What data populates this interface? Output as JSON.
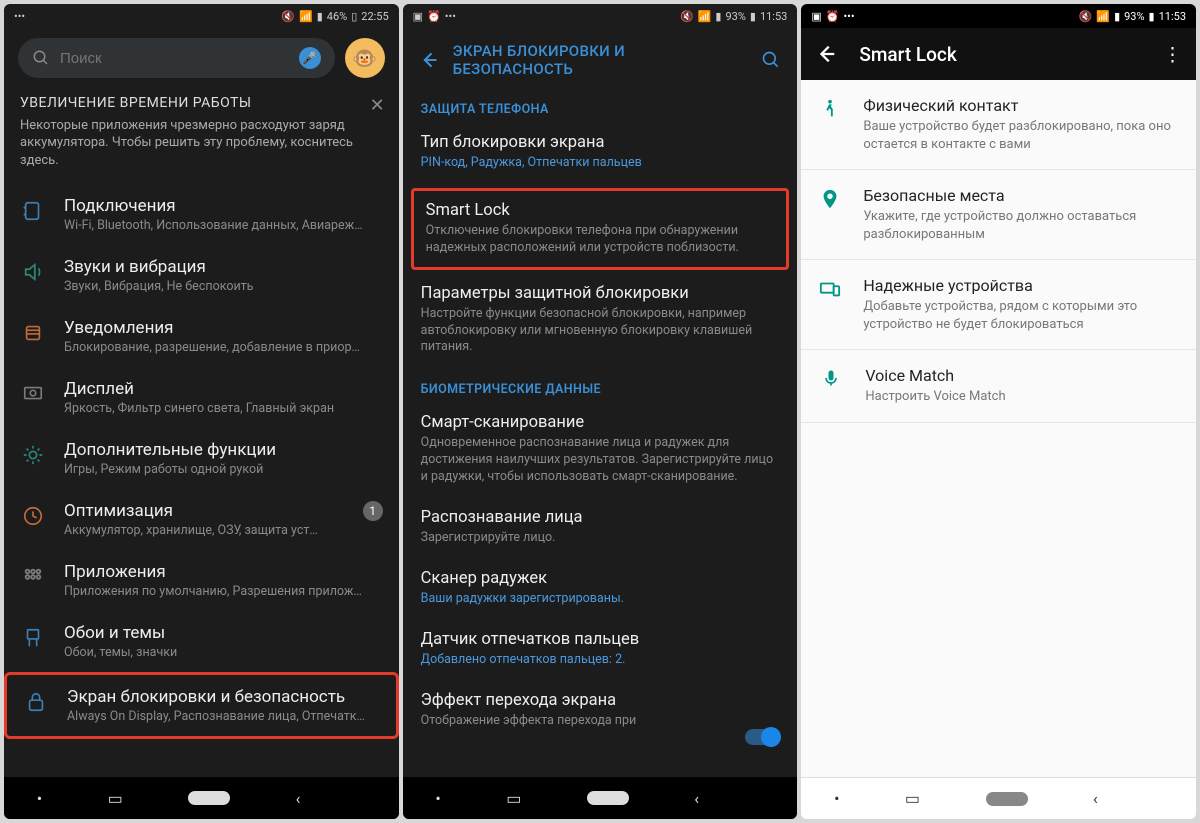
{
  "screen1": {
    "status": {
      "battery": "46%",
      "time": "22:55"
    },
    "search": {
      "placeholder": "Поиск"
    },
    "tip": {
      "title": "УВЕЛИЧЕНИЕ ВРЕМЕНИ РАБОТЫ",
      "body": "Некоторые приложения чрезмерно расходуют заряд аккумулятора. Чтобы решить эту проблему, коснитесь здесь."
    },
    "items": [
      {
        "title": "Подключения",
        "sub": "Wi-Fi, Bluetooth, Использование данных, Авиареж…",
        "icon": "connections"
      },
      {
        "title": "Звуки и вибрация",
        "sub": "Звуки, Вибрация, Не беспокоить",
        "icon": "sound"
      },
      {
        "title": "Уведомления",
        "sub": "Блокирование, разрешение, добавление в приор…",
        "icon": "notifications"
      },
      {
        "title": "Дисплей",
        "sub": "Яркость, Фильтр синего света, Главный экран",
        "icon": "display"
      },
      {
        "title": "Дополнительные функции",
        "sub": "Игры, Режим работы одной рукой",
        "icon": "advanced"
      },
      {
        "title": "Оптимизация",
        "sub": "Аккумулятор, хранилище, ОЗУ, защита уст…",
        "icon": "optimization",
        "badge": "1"
      },
      {
        "title": "Приложения",
        "sub": "Приложения по умолчанию, Разрешения прилож…",
        "icon": "apps"
      },
      {
        "title": "Обои и темы",
        "sub": "Обои, темы, значки",
        "icon": "themes"
      },
      {
        "title": "Экран блокировки и безопасность",
        "sub": "Always On Display, Распознавание лица, Отпечатк…",
        "icon": "lock",
        "highlight": true
      }
    ]
  },
  "screen2": {
    "status": {
      "battery": "93%",
      "time": "11:53"
    },
    "header": "ЭКРАН БЛОКИРОВКИ И БЕЗОПАСНОСТЬ",
    "section1": "ЗАЩИТА ТЕЛЕФОНА",
    "section2": "БИОМЕТРИЧЕСКИЕ ДАННЫЕ",
    "items1": [
      {
        "t": "Тип блокировки экрана",
        "s": "PIN-код, Радужка, Отпечатки пальцев",
        "blue": true
      },
      {
        "t": "Smart Lock",
        "s": "Отключение блокировки телефона при обнаружении надежных расположений или устройств поблизости.",
        "highlight": true
      },
      {
        "t": "Параметры защитной блокировки",
        "s": "Настройте функции безопасной блокировки, например автоблокировку или мгновенную блокировку клавишей питания."
      }
    ],
    "items2": [
      {
        "t": "Смарт-сканирование",
        "s": "Одновременное распознавание лица и радужек для достижения наилучших результатов. Зарегистрируйте лицо и радужки, чтобы использовать смарт-сканирование."
      },
      {
        "t": "Распознавание лица",
        "s": "Зарегистрируйте лицо."
      },
      {
        "t": "Сканер радужек",
        "s": "Ваши радужки зарегистрированы.",
        "blue": true
      },
      {
        "t": "Датчик отпечатков пальцев",
        "s": "Добавлено отпечатков пальцев: 2.",
        "blue": true
      },
      {
        "t": "Эффект перехода экрана",
        "s": "Отображение эффекта перехода при",
        "toggle": true
      }
    ]
  },
  "screen3": {
    "status": {
      "battery": "93%",
      "time": "11:53"
    },
    "title": "Smart Lock",
    "rows": [
      {
        "t": "Физический контакт",
        "s": "Ваше устройство будет разблокировано, пока оно остается в контакте с вами",
        "icon": "walk"
      },
      {
        "t": "Безопасные места",
        "s": "Укажите, где устройство должно оставаться разблокированным",
        "icon": "place"
      },
      {
        "t": "Надежные устройства",
        "s": "Добавьте устройства, рядом с которыми это устройство не будет блокироваться",
        "icon": "devices"
      },
      {
        "t": "Voice Match",
        "s": "Настроить Voice Match",
        "icon": "mic"
      }
    ]
  }
}
